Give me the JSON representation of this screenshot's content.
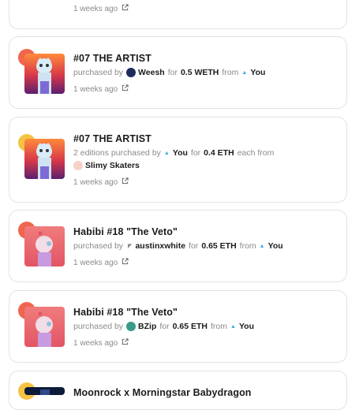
{
  "colors": {
    "accent_red": "#f0664d",
    "accent_yellow": "#f5c342",
    "you_blue": "#3da9e8"
  },
  "top_partial": {
    "timestamp": "1 weeks ago"
  },
  "activities": [
    {
      "badge": "red",
      "title": "#07 THE ARTIST",
      "prefix": "purchased by",
      "buyer": "Weesh",
      "for_word": "for",
      "price": "0.5 WETH",
      "from_word": "from",
      "seller": "You",
      "timestamp": "1 weeks ago"
    },
    {
      "badge": "yellow",
      "title": "#07 THE ARTIST",
      "prefix": "2 editions purchased by",
      "buyer": "You",
      "for_word": "for",
      "price": "0.4 ETH",
      "each_from": "each from",
      "seller": "Slimy Skaters",
      "timestamp": "1 weeks ago"
    },
    {
      "badge": "red",
      "title": "Habibi #18 \"The Veto\"",
      "prefix": "purchased by",
      "buyer": "austinxwhite",
      "for_word": "for",
      "price": "0.65 ETH",
      "from_word": "from",
      "seller": "You",
      "timestamp": "1 weeks ago"
    },
    {
      "badge": "red",
      "title": "Habibi #18 \"The Veto\"",
      "prefix": "purchased by",
      "buyer": "BZip",
      "for_word": "for",
      "price": "0.65 ETH",
      "from_word": "from",
      "seller": "You",
      "timestamp": "1 weeks ago"
    },
    {
      "badge": "yellow",
      "title": "Moonrock x Morningstar Babydragon"
    }
  ]
}
